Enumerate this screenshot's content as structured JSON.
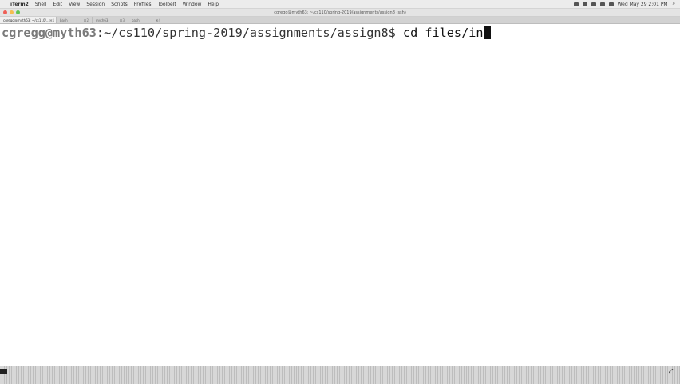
{
  "menubar": {
    "apple": "",
    "items": [
      "iTerm2",
      "Shell",
      "Edit",
      "View",
      "Session",
      "Scripts",
      "Profiles",
      "Toolbelt",
      "Window",
      "Help"
    ],
    "clock": "Wed May 29 2:01 PM",
    "spotlight": "⌕"
  },
  "window": {
    "title": "cgregg@myth63: ~/cs110/spring-2019/assignments/assign8 (ssh)"
  },
  "tabs": [
    {
      "label": "cgregg@myth63: ~/cs110/...",
      "num": "⌘1",
      "active": true
    },
    {
      "label": "bash",
      "num": "⌘2",
      "active": false
    },
    {
      "label": "myth63",
      "num": "⌘3",
      "active": false
    },
    {
      "label": "bash",
      "num": "⌘4",
      "active": false
    }
  ],
  "terminal": {
    "prompt_user": "cgregg@myth63",
    "prompt_path": ":~/cs110/spring-2019/assignments/assign8$ ",
    "command": "cd files/in"
  },
  "dock": {
    "right_glyph": "⤢"
  }
}
